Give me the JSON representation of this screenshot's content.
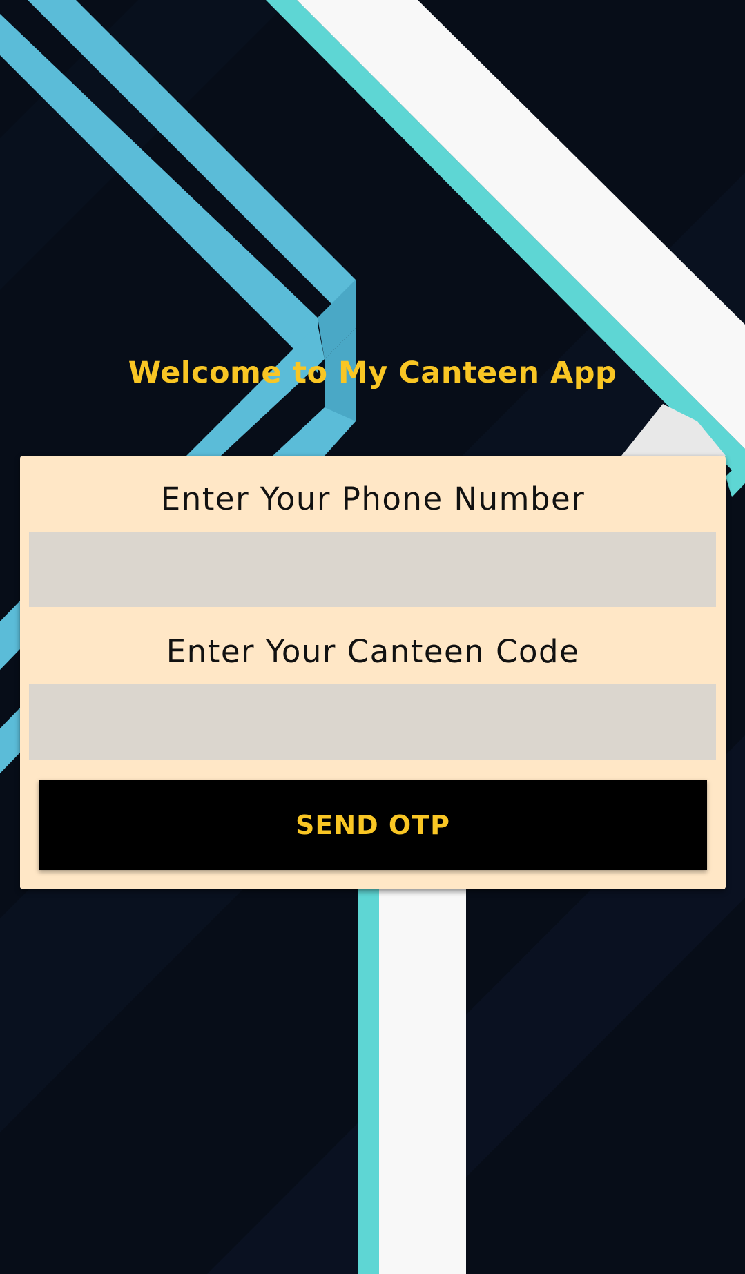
{
  "app": {
    "welcome_title": "Welcome to My Canteen App"
  },
  "form": {
    "phone_label": "Enter Your Phone Number",
    "phone_value": "",
    "canteen_label": "Enter Your Canteen Code",
    "canteen_value": "",
    "send_button_label": "SEND OTP"
  },
  "colors": {
    "background": "#070d18",
    "accent_yellow": "#f9c624",
    "card_background": "#ffe7c6",
    "input_background": "#dbd6ce",
    "stripe_blue": "#5bbcd8",
    "stripe_teal": "#5ed6d4",
    "stripe_white": "#f8f8f8"
  }
}
